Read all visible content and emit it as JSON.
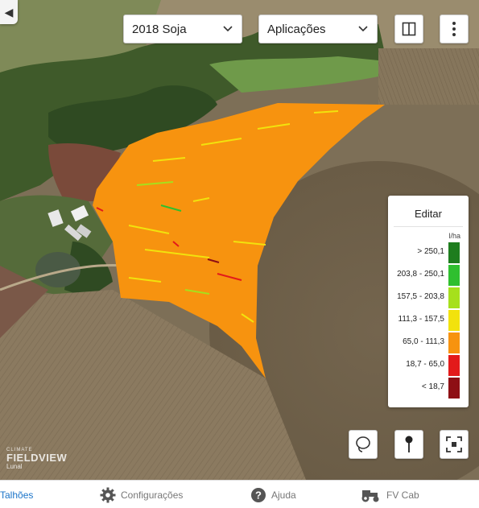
{
  "toolbar": {
    "season_select": "2018 Soja",
    "layer_select": "Aplicações"
  },
  "legend": {
    "edit_label": "Editar",
    "unit": "l/ha",
    "ranges": [
      {
        "label": "> 250,1",
        "color": "#1e7d1e"
      },
      {
        "label": "203,8 - 250,1",
        "color": "#2fbf2f"
      },
      {
        "label": "157,5 - 203,8",
        "color": "#a6e01c"
      },
      {
        "label": "111,3 - 157,5",
        "color": "#f2e20d"
      },
      {
        "label": "65,0 - 111,3",
        "color": "#f7930f"
      },
      {
        "label": "18,7 - 65,0",
        "color": "#e31a1a"
      },
      {
        "label": "< 18,7",
        "color": "#8e0f14"
      }
    ]
  },
  "watermark": {
    "small": "CLIMATE",
    "brand": "FIELDVIEW",
    "sub": "Lunal"
  },
  "tabs": {
    "talhoes": "Talhões",
    "config": "Configurações",
    "ajuda": "Ajuda",
    "fvcab": "FV Cab"
  },
  "colors": {
    "accent": "#1a73c8",
    "field_fill": "#f7930f"
  }
}
